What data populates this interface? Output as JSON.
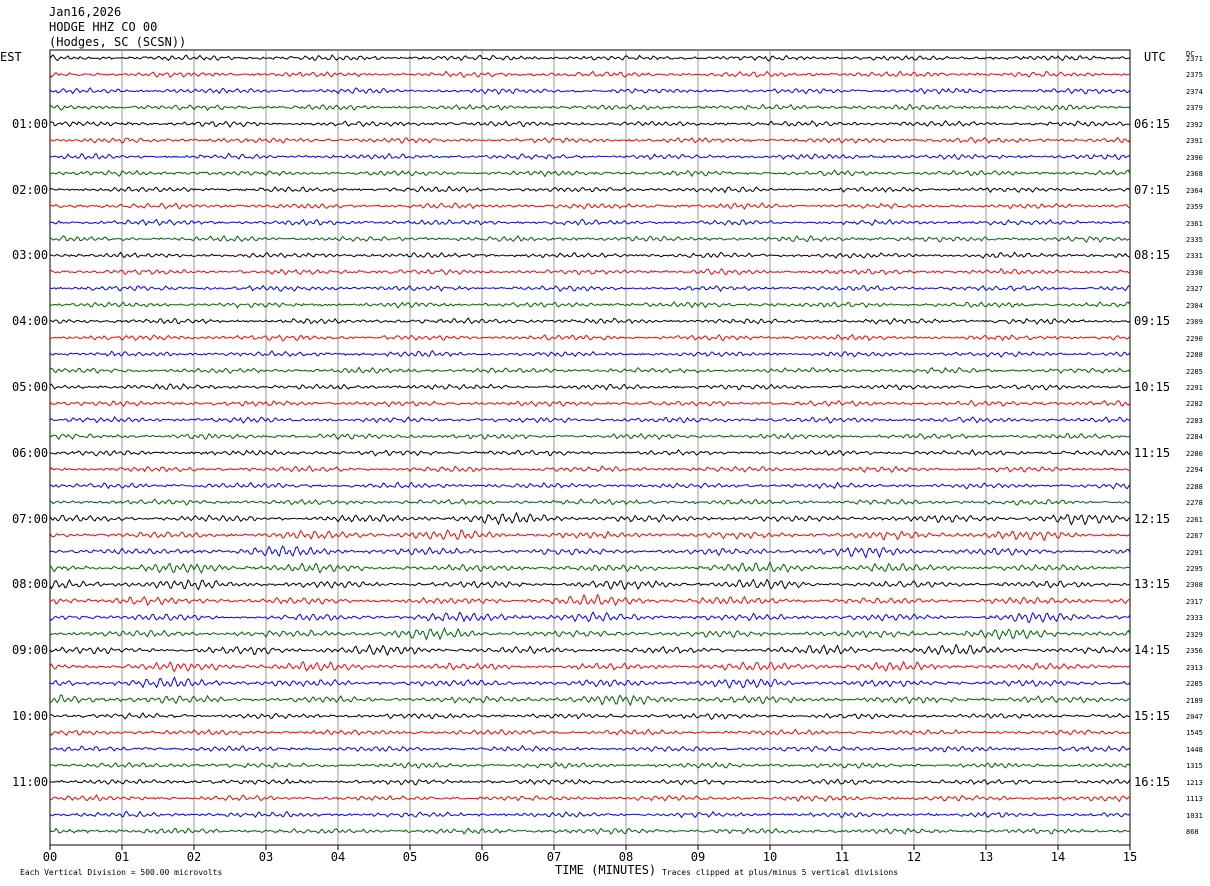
{
  "header": {
    "date": "Jan16,2026",
    "station": "HODGE HHZ CO 00",
    "location": "(Hodges, SC (SCSN))"
  },
  "left_timezone": "EST",
  "right_timezone": "UTC",
  "dc_label": "DC",
  "footer": {
    "scale_note": "Each Vertical Division =  500.00 microvolts",
    "xlabel": "TIME (MINUTES)",
    "clip_note": "Traces clipped at plus/minus 5 vertical divisions"
  },
  "chart_data": {
    "type": "line",
    "title": "HODGE HHZ CO 00",
    "xlabel": "TIME (MINUTES)",
    "x_ticks": [
      "00",
      "01",
      "02",
      "03",
      "04",
      "05",
      "06",
      "07",
      "08",
      "09",
      "10",
      "11",
      "12",
      "13",
      "14",
      "15"
    ],
    "xlim": [
      0,
      15
    ],
    "grid": true,
    "trace_colors": [
      "#000000",
      "#ff0000",
      "#0000ff",
      "#006400"
    ],
    "left_hour_labels": [
      "01:00",
      "02:00",
      "03:00",
      "04:00",
      "05:00",
      "06:00",
      "07:00",
      "08:00",
      "09:00",
      "10:00",
      "11:00"
    ],
    "right_hour_labels": [
      "06:15",
      "07:15",
      "08:15",
      "09:15",
      "10:15",
      "11:15",
      "12:15",
      "13:15",
      "14:15",
      "15:15",
      "16:15"
    ],
    "trace_dc_offsets": [
      2371,
      2375,
      2374,
      2379,
      2392,
      2391,
      2390,
      2368,
      2364,
      2359,
      2361,
      2335,
      2331,
      2330,
      2327,
      2304,
      2309,
      2290,
      2288,
      2285,
      2291,
      2282,
      2283,
      2284,
      2280,
      2294,
      2288,
      2278,
      2261,
      2267,
      2291,
      2295,
      2308,
      2317,
      2333,
      2329,
      2356,
      2313,
      2285,
      2189,
      2047,
      1545,
      1448,
      1315,
      1213,
      1113,
      1031,
      868
    ]
  }
}
